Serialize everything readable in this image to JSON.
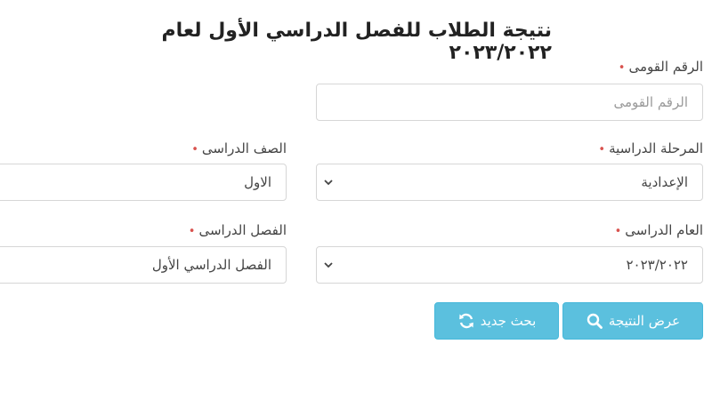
{
  "title": "نتيجة الطلاب للفصل الدراسي الأول لعام ٢٠٢٣/٢٠٢٢",
  "required_mark": "•",
  "national_id": {
    "label": "الرقم القومى",
    "placeholder": "الرقم القومى"
  },
  "stage": {
    "label": "المرحلة الدراسية",
    "value": "الإعدادية"
  },
  "grade": {
    "label": "الصف الدراسى",
    "value": "الاول"
  },
  "academic_year": {
    "label": "العام الدراسى",
    "value": "٢٠٢٣/٢٠٢٢"
  },
  "semester": {
    "label": "الفصل الدراسى",
    "value": "الفصل الدراسي الأول"
  },
  "buttons": {
    "show_result": "عرض النتيجة",
    "new_search": "بحث جديد"
  },
  "colors": {
    "button_bg": "#5bc0de",
    "required": "#d9534f"
  }
}
